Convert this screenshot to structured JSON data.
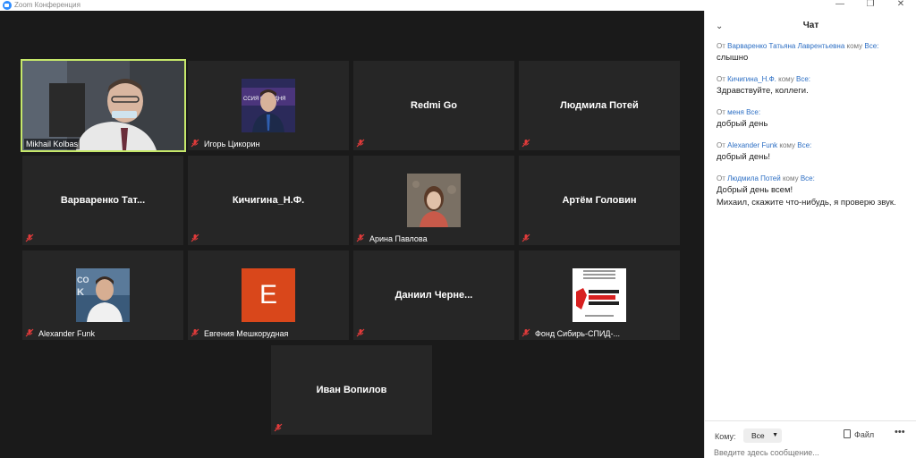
{
  "window": {
    "title": "Zoom Конференция",
    "minimize": "—",
    "maximize": "❐",
    "close": "✕"
  },
  "gallery": {
    "tiles": [
      {
        "name": "",
        "label": "Mikhail Kolbas",
        "active": true
      },
      {
        "name": "",
        "label": "Игорь Цикорин"
      },
      {
        "name": "Redmi Go",
        "label": ""
      },
      {
        "name": "Людмила Потей",
        "label": ""
      },
      {
        "name": "Варваренко Тат...",
        "label": ""
      },
      {
        "name": "Кичигина_Н.Ф.",
        "label": ""
      },
      {
        "name": "",
        "label": "Арина Павлова"
      },
      {
        "name": "Артём Головин",
        "label": ""
      },
      {
        "name": "",
        "label": "Alexander Funk"
      },
      {
        "name": "",
        "label": "Евгения Мешкорудная",
        "avatar_letter": "E"
      },
      {
        "name": "Даниил Черне...",
        "label": ""
      },
      {
        "name": "",
        "label": "Фонд Сибирь-СПИД-..."
      },
      {
        "name": "Иван Вопилов",
        "label": ""
      }
    ]
  },
  "chat": {
    "title": "Чат",
    "messages": [
      {
        "from_prefix": "От",
        "from": "Варваренко Татьяна Лаврентьевна",
        "to_prefix": "кому",
        "to": "Все:",
        "text": "слышно"
      },
      {
        "from_prefix": "От",
        "from": "Кичигина_Н.Ф.",
        "to_prefix": "кому",
        "to": "Все:",
        "text": "Здравствуйте, коллеги."
      },
      {
        "from_prefix": "От",
        "from": "меня",
        "to_prefix": "",
        "to": "Все:",
        "text": "добрый день"
      },
      {
        "from_prefix": "От",
        "from": "Alexander Funk",
        "to_prefix": "кому",
        "to": "Все:",
        "text": "добрый день!"
      },
      {
        "from_prefix": "От",
        "from": "Людмила Потей",
        "to_prefix": "кому",
        "to": "Все:",
        "text": "Добрый день всем!\nМихаил, скажите что-нибудь, я проверю звук."
      }
    ],
    "to_label": "Кому:",
    "to_value": "Все",
    "file_label": "Файл",
    "more": "•••",
    "input_placeholder": "Введите здесь сообщение..."
  },
  "colors": {
    "active_border": "#c6e86a",
    "chat_link": "#2d6fc4",
    "tile_bg": "#262626",
    "avatar_orange": "#d9471b"
  }
}
